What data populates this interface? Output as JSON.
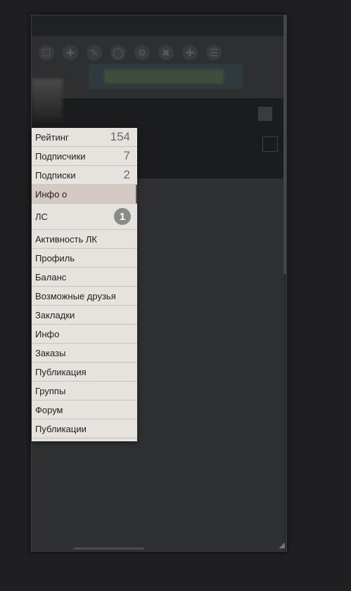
{
  "menu": {
    "items": [
      {
        "label": "Рейтинг",
        "count": "154"
      },
      {
        "label": "Подписчики",
        "count": "7"
      },
      {
        "label": "Подписки",
        "count": "2"
      },
      {
        "label": "Инфо о"
      },
      {
        "label": "ЛС",
        "badge": "1"
      },
      {
        "label": "Активность ЛК"
      },
      {
        "label": "Профиль"
      },
      {
        "label": "Баланс"
      },
      {
        "label": "Возможные друзья"
      },
      {
        "label": "Закладки"
      },
      {
        "label": "Инфо"
      },
      {
        "label": "Заказы"
      },
      {
        "label": "Публикация"
      },
      {
        "label": "Группы"
      },
      {
        "label": "Форум"
      },
      {
        "label": "Публикации"
      }
    ],
    "active_index": 3
  },
  "colors": {
    "background": "#1f1f21",
    "menu_bg": "#e6e3df",
    "menu_active": "#d6c9c4",
    "badge": "#8a8a8a"
  }
}
